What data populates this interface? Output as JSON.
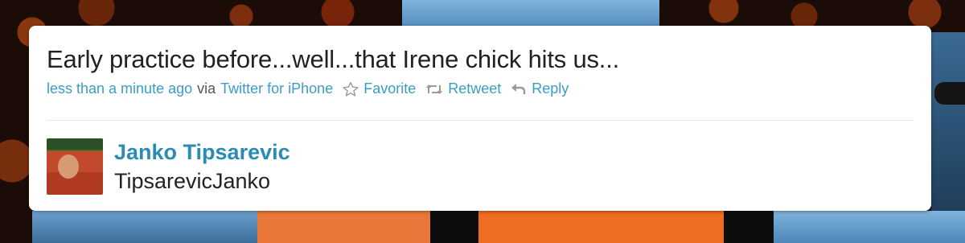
{
  "tweet": {
    "text": "Early practice before...well...that Irene chick hits us...",
    "timestamp": "less than a minute ago",
    "via_label": "via",
    "source": "Twitter for iPhone",
    "actions": {
      "favorite": "Favorite",
      "retweet": "Retweet",
      "reply": "Reply"
    }
  },
  "author": {
    "display_name": "Janko Tipsarevic",
    "screen_name": "TipsarevicJanko"
  },
  "colors": {
    "link": "#3a9dc5",
    "name": "#2a8cb3",
    "text": "#222222"
  },
  "icons": {
    "favorite": "star-icon",
    "retweet": "retweet-icon",
    "reply": "reply-icon"
  }
}
